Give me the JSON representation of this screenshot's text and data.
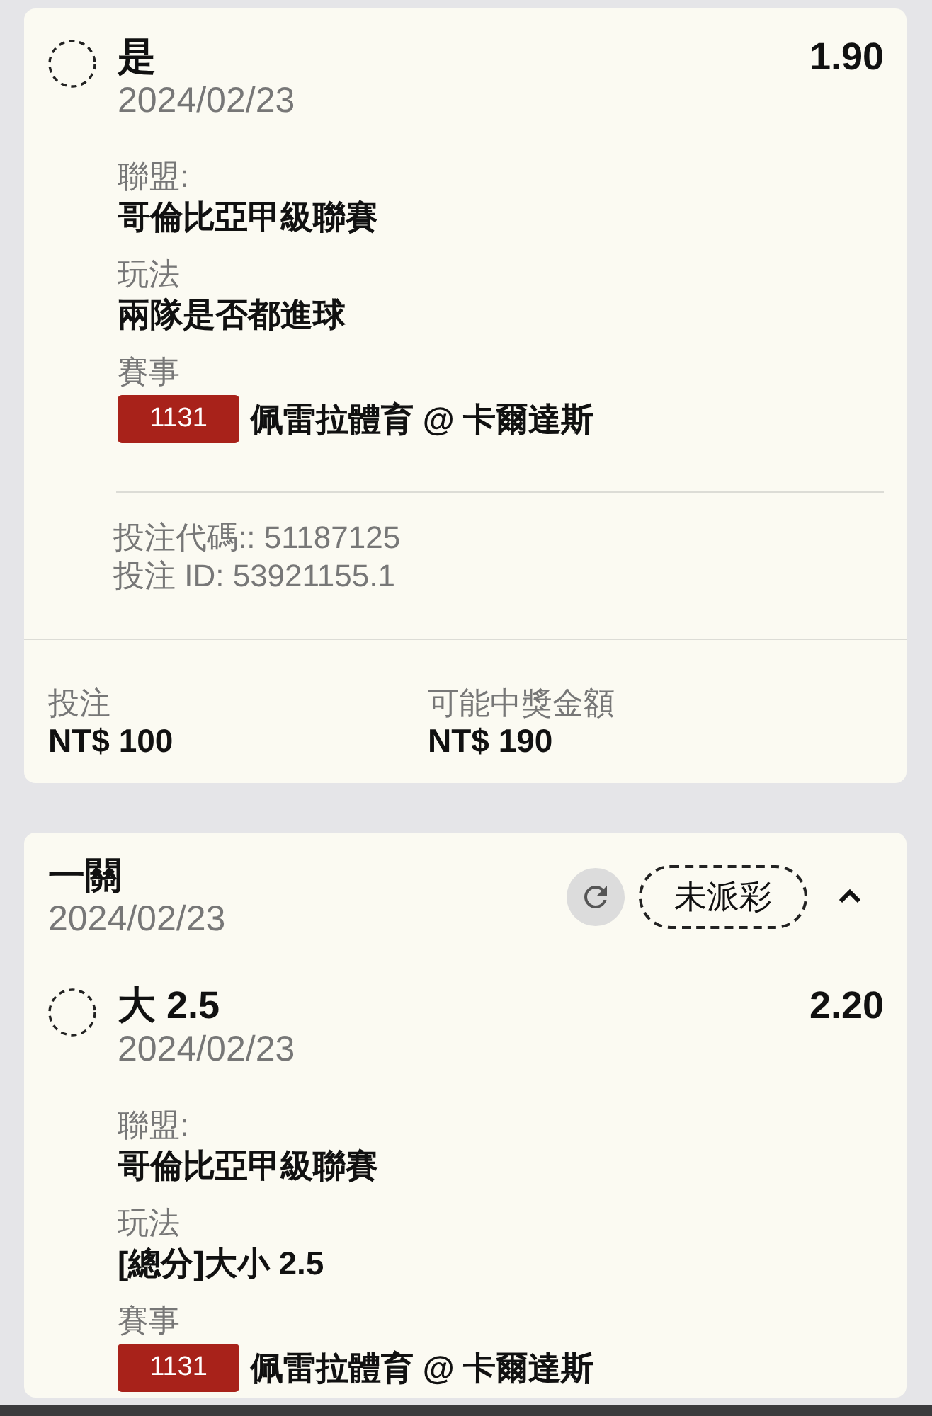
{
  "bets": [
    {
      "selections": [
        {
          "pick": "是",
          "date": "2024/02/23",
          "odds": "1.90",
          "fields": [
            {
              "label": "聯盟:",
              "value": "哥倫比亞甲級聯賽"
            },
            {
              "label": "玩法",
              "value": "兩隊是否都進球"
            },
            {
              "label": "賽事",
              "match_code": "1131",
              "value": "佩雷拉體育 @ 卡爾達斯"
            }
          ]
        }
      ],
      "references": [
        "投注代碼:: 51187125",
        "投注 ID: 53921155.1"
      ],
      "totals": [
        {
          "label": "投注",
          "amount": "NT$ 100"
        },
        {
          "label": "可能中獎金額",
          "amount": "NT$ 190"
        }
      ]
    },
    {
      "title": "一關",
      "date": "2024/02/23",
      "status": "未派彩",
      "expanded": true,
      "selections": [
        {
          "pick": "大 2.5",
          "date": "2024/02/23",
          "odds": "2.20",
          "fields": [
            {
              "label": "聯盟:",
              "value": "哥倫比亞甲級聯賽"
            },
            {
              "label": "玩法",
              "value": "[總分]大小 2.5"
            },
            {
              "label": "賽事",
              "match_code": "1131",
              "value": "佩雷拉體育 @ 卡爾達斯"
            }
          ]
        }
      ]
    }
  ]
}
